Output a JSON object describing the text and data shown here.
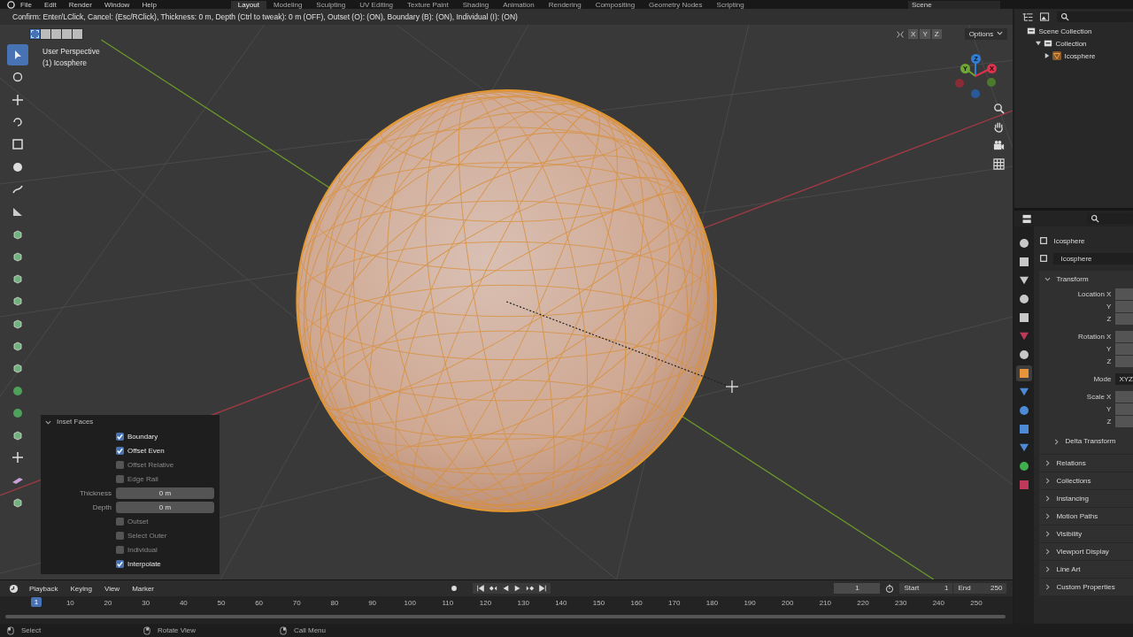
{
  "top_menu": [
    "File",
    "Edit",
    "Render",
    "Window",
    "Help"
  ],
  "workspaces": [
    {
      "label": "Layout",
      "selected": true
    },
    {
      "label": "Modeling",
      "selected": false
    },
    {
      "label": "Sculpting",
      "selected": false
    },
    {
      "label": "UV Editing",
      "selected": false
    },
    {
      "label": "Texture Paint",
      "selected": false
    },
    {
      "label": "Shading",
      "selected": false
    },
    {
      "label": "Animation",
      "selected": false
    },
    {
      "label": "Rendering",
      "selected": false
    },
    {
      "label": "Compositing",
      "selected": false
    },
    {
      "label": "Geometry Nodes",
      "selected": false
    },
    {
      "label": "Scripting",
      "selected": false
    }
  ],
  "scene": "Scene",
  "status_hint": "Confirm: Enter/LClick, Cancel: (Esc/RClick), Thickness: 0 m, Depth (Ctrl to tweak): 0 m (OFF), Outset (O): (ON), Boundary (B): (ON), Individual (I): (ON)",
  "tools": [
    {
      "selected": true
    },
    {
      "selected": false
    },
    {
      "selected": false
    },
    {
      "selected": false
    },
    {
      "selected": false
    },
    {
      "selected": false
    },
    {
      "selected": false
    },
    {
      "selected": false
    },
    {
      "selected": false
    },
    {
      "selected": false
    },
    {
      "selected": false
    },
    {
      "selected": false
    },
    {
      "selected": false
    },
    {
      "selected": false
    },
    {
      "selected": false
    },
    {
      "selected": false
    },
    {
      "selected": false
    },
    {
      "selected": false
    },
    {
      "selected": false
    },
    {
      "selected": false
    },
    {
      "selected": false
    }
  ],
  "viewport": {
    "select_modes": [
      {
        "selected": true
      },
      {
        "selected": false
      },
      {
        "selected": false
      },
      {
        "selected": false
      },
      {
        "selected": false
      }
    ],
    "view_name": "User Perspective",
    "object_label": "(1) Icosphere",
    "axis_toggles": [
      "X",
      "Y",
      "Z"
    ],
    "options": "Options",
    "gizmo_axes": [
      {
        "label": "Z",
        "color": "#2f7fd8"
      },
      {
        "label": "Y",
        "color": "#6ea832"
      },
      {
        "label": "X",
        "color": "#d6354c"
      }
    ]
  },
  "operator_panel": {
    "title": "Inset Faces",
    "expanded": true,
    "rows": [
      {
        "kind": "checkbox",
        "label": "Boundary",
        "checked": true
      },
      {
        "kind": "checkbox",
        "label": "Offset Even",
        "checked": true
      },
      {
        "kind": "checkbox",
        "label": "Offset Relative",
        "checked": false
      },
      {
        "kind": "checkbox",
        "label": "Edge Rail",
        "checked": false
      },
      {
        "kind": "field",
        "label": "Thickness",
        "value": "0 m"
      },
      {
        "kind": "field",
        "label": "Depth",
        "value": "0 m"
      },
      {
        "kind": "checkbox",
        "label": "Outset",
        "checked": false
      },
      {
        "kind": "checkbox",
        "label": "Select Outer",
        "checked": false
      },
      {
        "kind": "checkbox",
        "label": "Individual",
        "checked": false
      },
      {
        "kind": "checkbox",
        "label": "Interpolate",
        "checked": true
      }
    ]
  },
  "outliner": {
    "items": [
      {
        "label": "Scene Collection",
        "children": [
          {
            "label": "Collection",
            "expanded": true,
            "children": [
              {
                "label": "Icosphere",
                "expanded": false
              }
            ]
          }
        ]
      }
    ]
  },
  "properties": {
    "tabs": [
      {
        "color": "#c8c8c8",
        "selected": false
      },
      {
        "color": "#c8c8c8",
        "selected": false
      },
      {
        "color": "#c8c8c8",
        "selected": false
      },
      {
        "color": "#c8c8c8",
        "selected": false
      },
      {
        "color": "#c8c8c8",
        "selected": false
      },
      {
        "color": "#c0395a",
        "selected": false
      },
      {
        "color": "#c8c8c8",
        "selected": false
      },
      {
        "color": "#e8943a",
        "selected": true
      },
      {
        "color": "#4d8ad6",
        "selected": false
      },
      {
        "color": "#4d8ad6",
        "selected": false
      },
      {
        "color": "#4d8ad6",
        "selected": false
      },
      {
        "color": "#4d8ad6",
        "selected": false
      },
      {
        "color": "#3fb04f",
        "selected": false
      },
      {
        "color": "#c0395a",
        "selected": false
      }
    ],
    "object_name": "Icosphere",
    "datablock": "Icosphere",
    "transform": {
      "title": "Transform",
      "expanded": true,
      "rows": [
        {
          "label": "Location X"
        },
        {
          "label": "Y"
        },
        {
          "label": "Z"
        },
        {
          "label": "Rotation X"
        },
        {
          "label": "Y"
        },
        {
          "label": "Z"
        },
        {
          "label": "Mode",
          "value": "XYZ"
        },
        {
          "label": "Scale X"
        },
        {
          "label": "Y"
        },
        {
          "label": "Z"
        }
      ],
      "subpanel": "Delta Transform"
    },
    "panels": [
      "Relations",
      "Collections",
      "Instancing",
      "Motion Paths",
      "Visibility",
      "Viewport Display",
      "Line Art",
      "Custom Properties"
    ]
  },
  "timeline": {
    "menus": [
      "Playback",
      "Keying",
      "View",
      "Marker"
    ],
    "current_frame": "1",
    "start_label": "Start",
    "start": "1",
    "end_label": "End",
    "end": "250",
    "playhead": "1",
    "ticks": [
      "10",
      "20",
      "30",
      "40",
      "50",
      "60",
      "70",
      "80",
      "90",
      "100",
      "110",
      "120",
      "130",
      "140",
      "150",
      "160",
      "170",
      "180",
      "190",
      "200",
      "210",
      "220",
      "230",
      "240",
      "250"
    ]
  },
  "status_bar": [
    "Select",
    "Rotate View",
    "Call Menu"
  ]
}
